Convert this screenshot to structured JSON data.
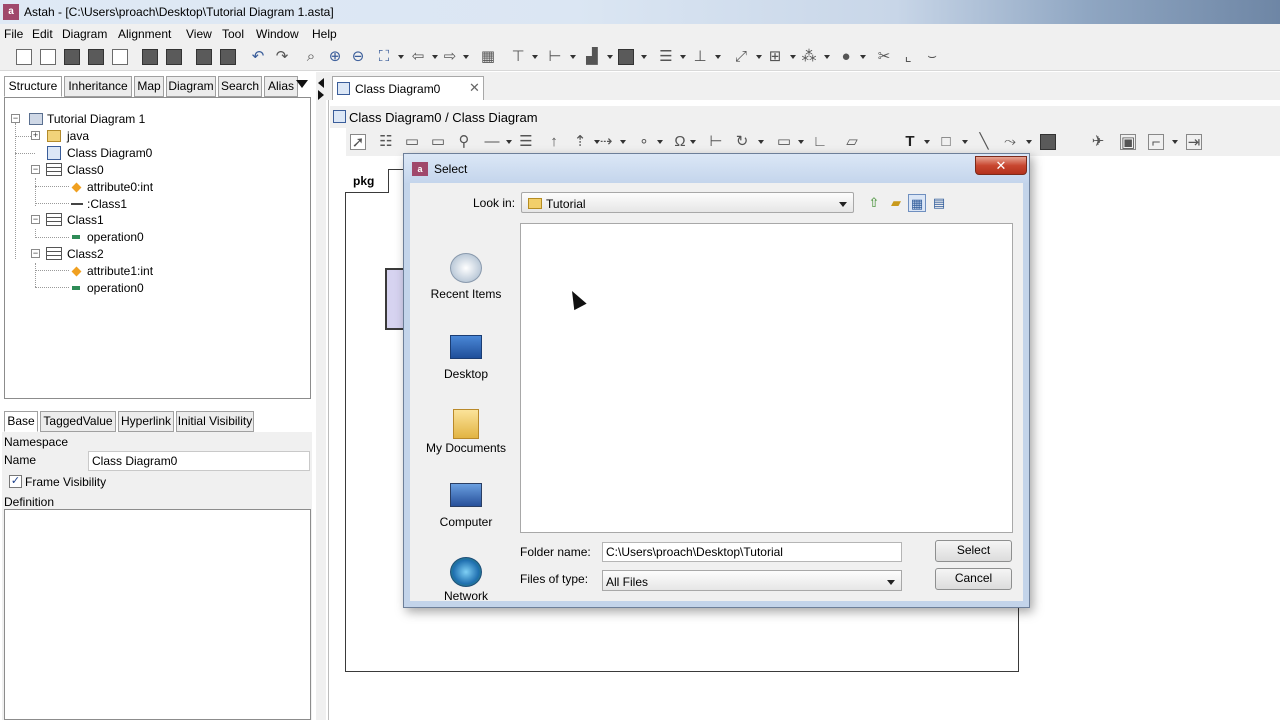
{
  "window": {
    "app_icon": "astah-icon",
    "title": "Astah - [C:\\Users\\proach\\Desktop\\Tutorial Diagram 1.asta]"
  },
  "menu": [
    "File",
    "Edit",
    "Diagram",
    "Alignment",
    "View",
    "Tool",
    "Window",
    "Help"
  ],
  "left_tabs": [
    "Structure",
    "Inheritance",
    "Map",
    "Diagram",
    "Search",
    "Alias"
  ],
  "tree": {
    "root": "Tutorial Diagram 1",
    "java": "java",
    "class_diagram": "Class Diagram0",
    "class0": "Class0",
    "class0_attr": "attribute0:int",
    "class0_assoc": ":Class1",
    "class1": "Class1",
    "class1_op": "operation0",
    "class2": "Class2",
    "class2_attr": "attribute1:int",
    "class2_op": "operation0"
  },
  "bottom_tabs": [
    "Base",
    "TaggedValue",
    "Hyperlink",
    "Initial Visibility"
  ],
  "properties": {
    "namespace_label": "Namespace",
    "name_label": "Name",
    "name_value": "Class Diagram0",
    "frame_visibility_label": "Frame Visibility",
    "frame_visibility_checked": "✓",
    "definition_label": "Definition"
  },
  "editor": {
    "tab_label": "Class Diagram0",
    "tab_close": "✕",
    "path": "Class Diagram0 / Class Diagram",
    "frame_tab": "pkg"
  },
  "dialog": {
    "icon": "astah-icon",
    "title": "Select",
    "close": "✕",
    "look_in_label": "Look in:",
    "look_in_value": "Tutorial",
    "places": [
      "Recent Items",
      "Desktop",
      "My Documents",
      "Computer",
      "Network"
    ],
    "folder_name_label": "Folder name:",
    "folder_name_value": "C:\\Users\\proach\\Desktop\\Tutorial",
    "files_of_type_label": "Files of type:",
    "files_of_type_value": "All Files",
    "select_button": "Select",
    "cancel_button": "Cancel"
  },
  "colors": {
    "accent": "#3a5d9a",
    "app_icon": "#a0486b",
    "dialog_frame": "#c3d4ea",
    "close_button": "#c84730"
  }
}
